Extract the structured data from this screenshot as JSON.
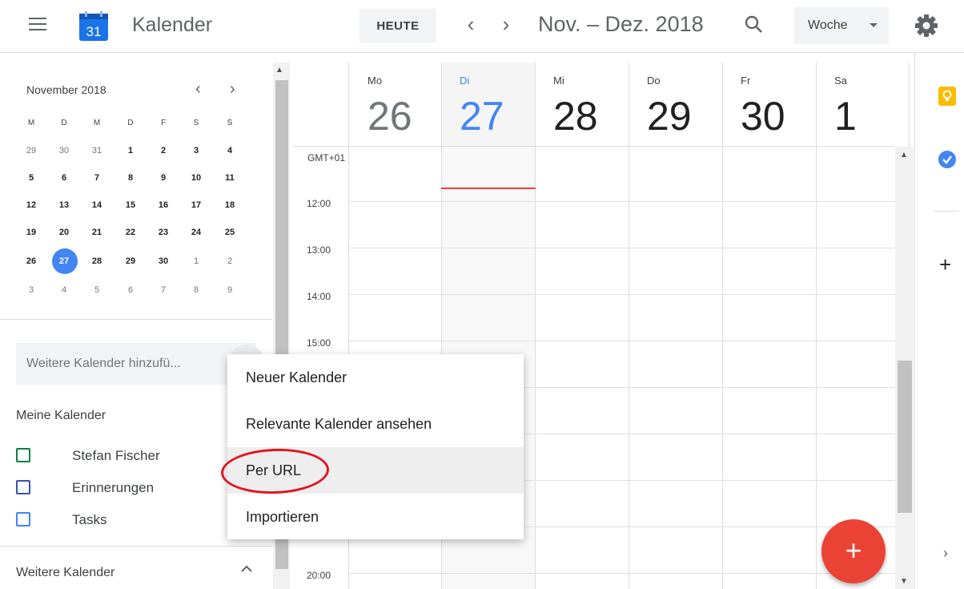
{
  "header": {
    "logo_day": "31",
    "app_title": "Kalender",
    "today_label": "HEUTE",
    "prev_label": "‹",
    "next_label": "›",
    "date_range": "Nov. – Dez. 2018",
    "view_label": "Woche"
  },
  "mini_calendar": {
    "title": "November 2018",
    "weekdays": [
      "M",
      "D",
      "M",
      "D",
      "F",
      "S",
      "S"
    ],
    "weeks": [
      [
        "29",
        "30",
        "31",
        "1",
        "2",
        "3",
        "4"
      ],
      [
        "5",
        "6",
        "7",
        "8",
        "9",
        "10",
        "11"
      ],
      [
        "12",
        "13",
        "14",
        "15",
        "16",
        "17",
        "18"
      ],
      [
        "19",
        "20",
        "21",
        "22",
        "23",
        "24",
        "25"
      ],
      [
        "26",
        "27",
        "28",
        "29",
        "30",
        "1",
        "2"
      ],
      [
        "3",
        "4",
        "5",
        "6",
        "7",
        "8",
        "9"
      ]
    ]
  },
  "sidebar": {
    "add_calendar_placeholder": "Weitere Kalender hinzufü...",
    "my_calendars_title": "Meine Kalender",
    "my_calendars": [
      {
        "label": "Stefan Fischer",
        "color": "#0b8043"
      },
      {
        "label": "Erinnerungen",
        "color": "#3f51b5"
      },
      {
        "label": "Tasks",
        "color": "#4285f4"
      }
    ],
    "other_calendars_title": "Weitere Kalender"
  },
  "week": {
    "days": [
      {
        "name": "Mo",
        "num": "26"
      },
      {
        "name": "Di",
        "num": "27"
      },
      {
        "name": "Mi",
        "num": "28"
      },
      {
        "name": "Do",
        "num": "29"
      },
      {
        "name": "Fr",
        "num": "30"
      },
      {
        "name": "Sa",
        "num": "1"
      }
    ],
    "timezone": "GMT+01",
    "times": [
      "12:00",
      "13:00",
      "14:00",
      "15:00",
      "20:00"
    ]
  },
  "menu": {
    "items": [
      {
        "label": "Neuer Kalender"
      },
      {
        "label": "Relevante Kalender ansehen"
      },
      {
        "label": "Per URL"
      },
      {
        "label": "Importieren"
      }
    ]
  },
  "fab_label": "+",
  "colors": {
    "accent": "#4285f4",
    "now_line": "#ea4335",
    "fab": "#ea4335",
    "annotation": "#e0151f"
  }
}
